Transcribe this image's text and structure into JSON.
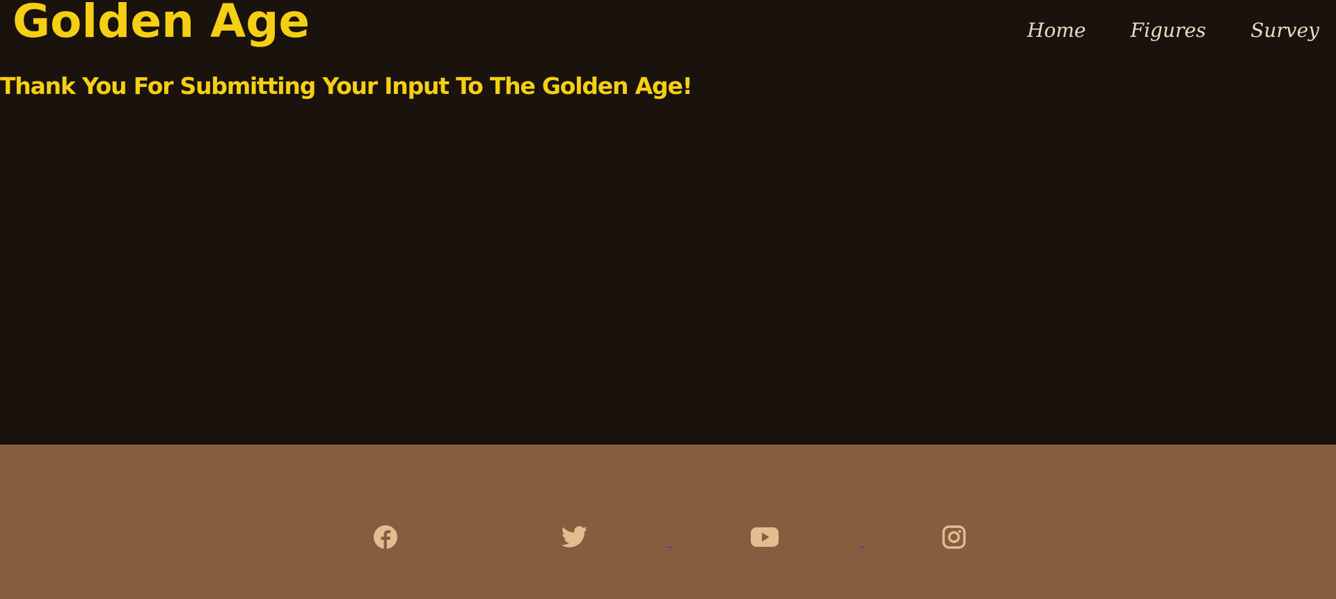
{
  "header": {
    "brand": "Golden Age",
    "nav": [
      {
        "label": "Home"
      },
      {
        "label": "Figures"
      },
      {
        "label": "Survey"
      }
    ]
  },
  "main": {
    "message": "Thank You For Submitting Your Input To The Golden Age!"
  },
  "footer": {
    "social_icons": [
      "facebook-icon",
      "twitter-icon",
      "youtube-icon",
      "instagram-icon"
    ]
  },
  "colors": {
    "background": "#1a120d",
    "gold": "#f5cf14",
    "nav_text": "#e8dcc3",
    "footer_bg": "#865d3e",
    "icon": "#e2bd90"
  }
}
